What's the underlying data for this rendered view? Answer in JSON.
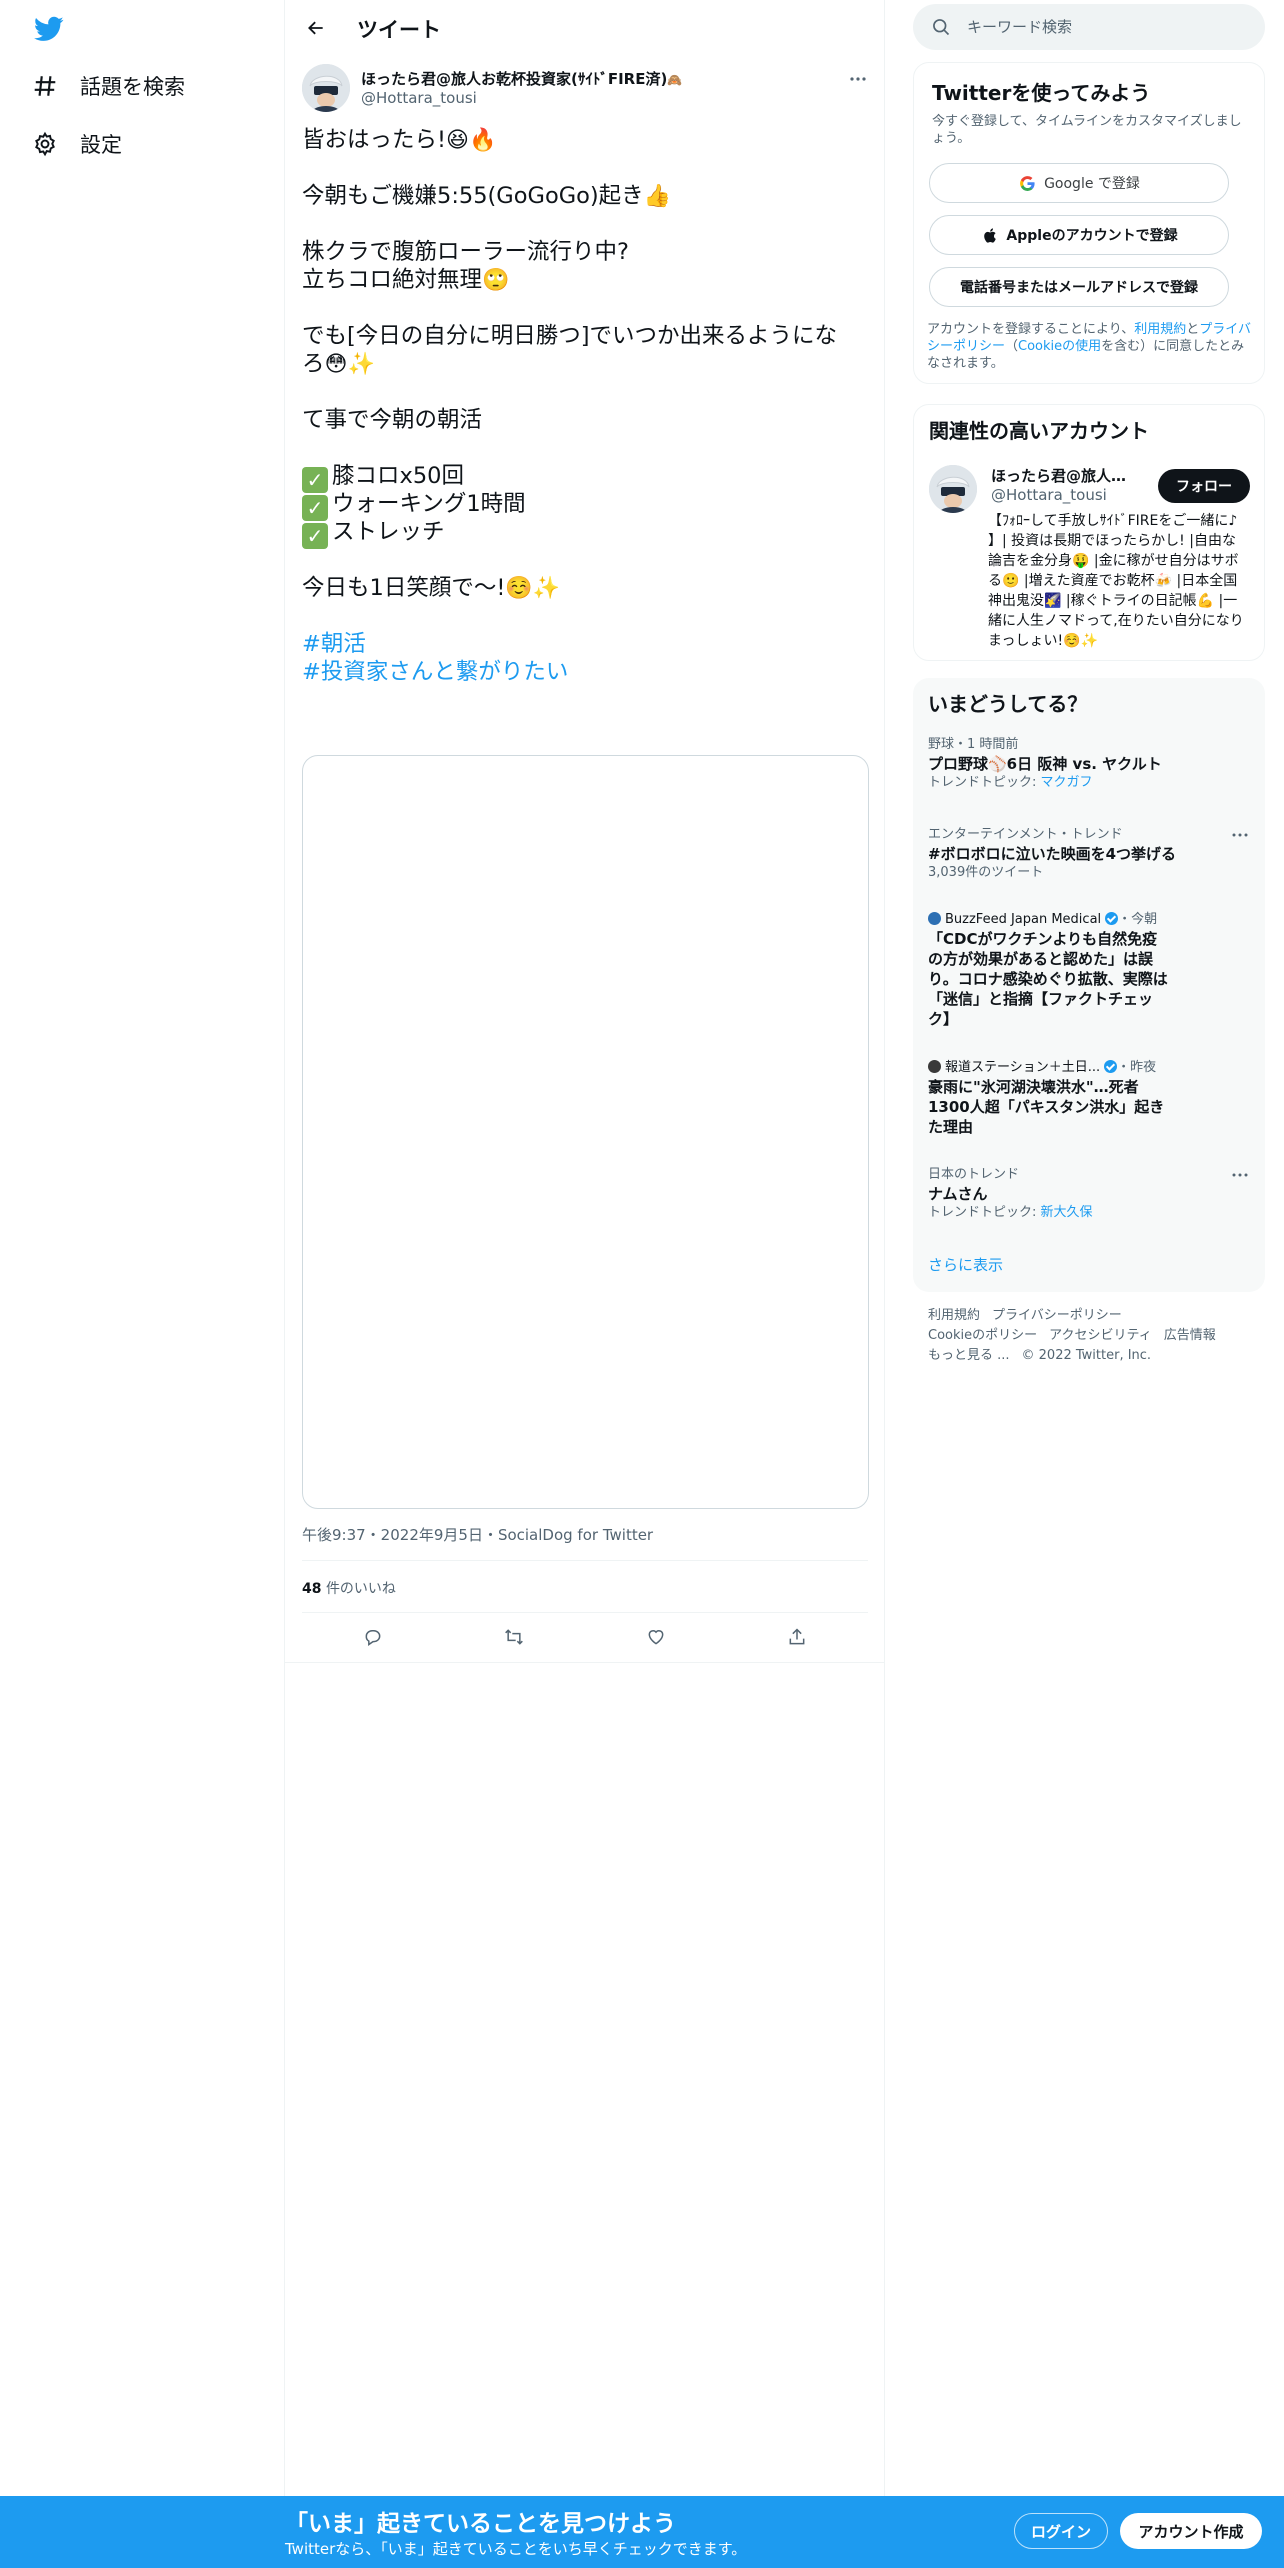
{
  "colors": {
    "accent": "#1d9bf0",
    "text": "#0f1419",
    "secondary": "#536471",
    "border": "#eff3f4",
    "check_green": "#77b255"
  },
  "left_nav": {
    "logo_icon": "twitter-bird-icon",
    "items": [
      {
        "icon": "hashtag-icon",
        "label": "話題を検索"
      },
      {
        "icon": "gear-icon",
        "label": "設定"
      }
    ]
  },
  "header": {
    "back_icon": "arrow-left-icon",
    "title": "ツイート"
  },
  "tweet": {
    "display_name": "ほったら君@旅人お乾杯投資家(ｻｲﾄﾞFIRE済)",
    "name_emoji": "🙈",
    "handle": "@Hottara_tousi",
    "lines": {
      "l1": "皆おはったら!",
      "l2": "今朝もご機嫌5:55(GoGoGo)起き",
      "l3": "株クラで腹筋ローラー流行り中?",
      "l4": "立ちコロ絶対無理",
      "l5": "でも[今日の自分に明日勝つ]でいつか出来るようにな",
      "l6": "ろ",
      "l7": "て事で今朝の朝活",
      "l8": "膝コロx50回",
      "l9": "ウォーキング1時間",
      "l10": "ストレッチ",
      "l11": "今日も1日笑顔で〜!",
      "hashtag1": "#朝活",
      "hashtag2": "#投資家さんと繋がりたい"
    },
    "emoji": {
      "laugh": "😆",
      "fire": "🔥",
      "thumbs": "👍",
      "roll": "🙄",
      "flushed": "😳",
      "sparkles": "✨",
      "smile": "☺️",
      "check": "✓"
    },
    "timestamp": "午後9:37・2022年9月5日・SocialDog for Twitter",
    "likes_count": "48",
    "likes_label": "件のいいね",
    "actions": [
      "reply-icon",
      "retweet-icon",
      "like-icon",
      "share-icon"
    ]
  },
  "search": {
    "placeholder": "キーワード検索"
  },
  "signup": {
    "title": "Twitterを使ってみよう",
    "subtitle": "今すぐ登録して、タイムラインをカスタマイズしましょう。",
    "google": "Google で登録",
    "apple": "Appleのアカウントで登録",
    "phone": "電話番号またはメールアドレスで登録",
    "legal_1": "アカウントを登録することにより、",
    "legal_link1": "利用規約",
    "legal_2": "と",
    "legal_link2": "プライバシーポリシー",
    "legal_3": "（",
    "legal_link3": "Cookieの使用",
    "legal_4": "を含む）に同意したとみなされます。"
  },
  "accounts": {
    "title": "関連性の高いアカウント",
    "name": "ほったら君@旅人お...",
    "handle": "@Hottara_tousi",
    "follow": "フォロー",
    "bio": "【ﾌｫﾛｰして手放しｻｲﾄﾞFIREをご一緒に♪ 】| 投資は長期でほったらかし! |自由な論吉を金分身🤑 |金に稼がせ自分はサボる🙂 |増えた資産でお乾杯🍻 |日本全国神出鬼没🌠 |稼ぐトライの日記帳💪 |一緒に人生ノマドって,在りたい自分になりまっしょい!☺️✨"
  },
  "trends": {
    "title": "いまどうしてる？",
    "items": [
      {
        "meta": "野球・1 時間前",
        "name": "プロ野球⚾6日 阪神 vs. ヤクルト",
        "sub_prefix": "トレンドトピック: ",
        "sub_topic": "マクガフ"
      },
      {
        "meta": "エンターテインメント・トレンド",
        "name": "#ボロボロに泣いた映画を4つ挙げる",
        "sub": "3,039件のツイート"
      },
      {
        "source": "BuzzFeed Japan Medical",
        "time": "・今朝",
        "name": "「CDCがワクチンよりも自然免疫の方が効果があると認めた」は誤り。コロナ感染めぐり拡散、実際は「迷信」と指摘【ファクトチェック】"
      },
      {
        "source": "報道ステーション＋土日...",
        "time": "・昨夜",
        "name": "豪雨に\"氷河湖決壊洪水\"…死者1300人超「パキスタン洪水」起きた理由"
      },
      {
        "meta": "日本のトレンド",
        "name": "ナムさん",
        "sub_prefix": "トレンドトピック: ",
        "sub_topic": "新大久保"
      }
    ],
    "show_more": "さらに表示"
  },
  "footer": {
    "links": [
      "利用規約",
      "プライバシーポリシー",
      "Cookieのポリシー",
      "アクセシビリティ",
      "広告情報",
      "もっと見る ..."
    ],
    "copyright": "© 2022 Twitter, Inc."
  },
  "bottom_bar": {
    "title": "「いま」起きていることを見つけよう",
    "subtitle": "Twitterなら、「いま」起きていることをいち早くチェックできます。",
    "login": "ログイン",
    "signup": "アカウント作成"
  }
}
